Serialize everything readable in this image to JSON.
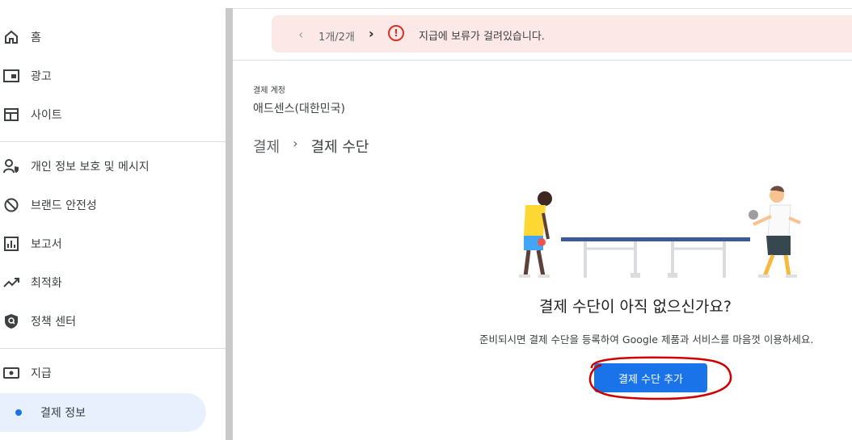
{
  "sidebar": {
    "items": [
      {
        "label": "홈",
        "icon": "home-icon"
      },
      {
        "label": "광고",
        "icon": "ads-icon"
      },
      {
        "label": "사이트",
        "icon": "sites-icon"
      },
      {
        "label": "개인 정보 보호 및 메시지",
        "icon": "privacy-icon"
      },
      {
        "label": "브랜드 안전성",
        "icon": "block-icon"
      },
      {
        "label": "보고서",
        "icon": "reports-icon"
      },
      {
        "label": "최적화",
        "icon": "trending-icon"
      },
      {
        "label": "정책 센터",
        "icon": "shield-icon"
      },
      {
        "label": "지급",
        "icon": "payments-icon"
      },
      {
        "label": "결제 정보",
        "icon": "dot-icon"
      }
    ]
  },
  "alert": {
    "count": "1개/2개",
    "message": "지급에 보류가 걸려있습니다.",
    "accent": "#d93025",
    "background": "#fce8e6"
  },
  "account": {
    "label": "결제 계정",
    "name": "애드센스(대한민국)"
  },
  "breadcrumb": {
    "parent": "결제",
    "current": "결제 수단"
  },
  "empty_state": {
    "title": "결제 수단이 아직 없으신가요?",
    "description": "준비되시면 결제 수단을 등록하여 Google 제품과 서비스를 마음껏 이용하세요.",
    "button_label": "결제 수단 추가"
  },
  "colors": {
    "accent": "#1a73e8",
    "annotation": "#d00000"
  }
}
